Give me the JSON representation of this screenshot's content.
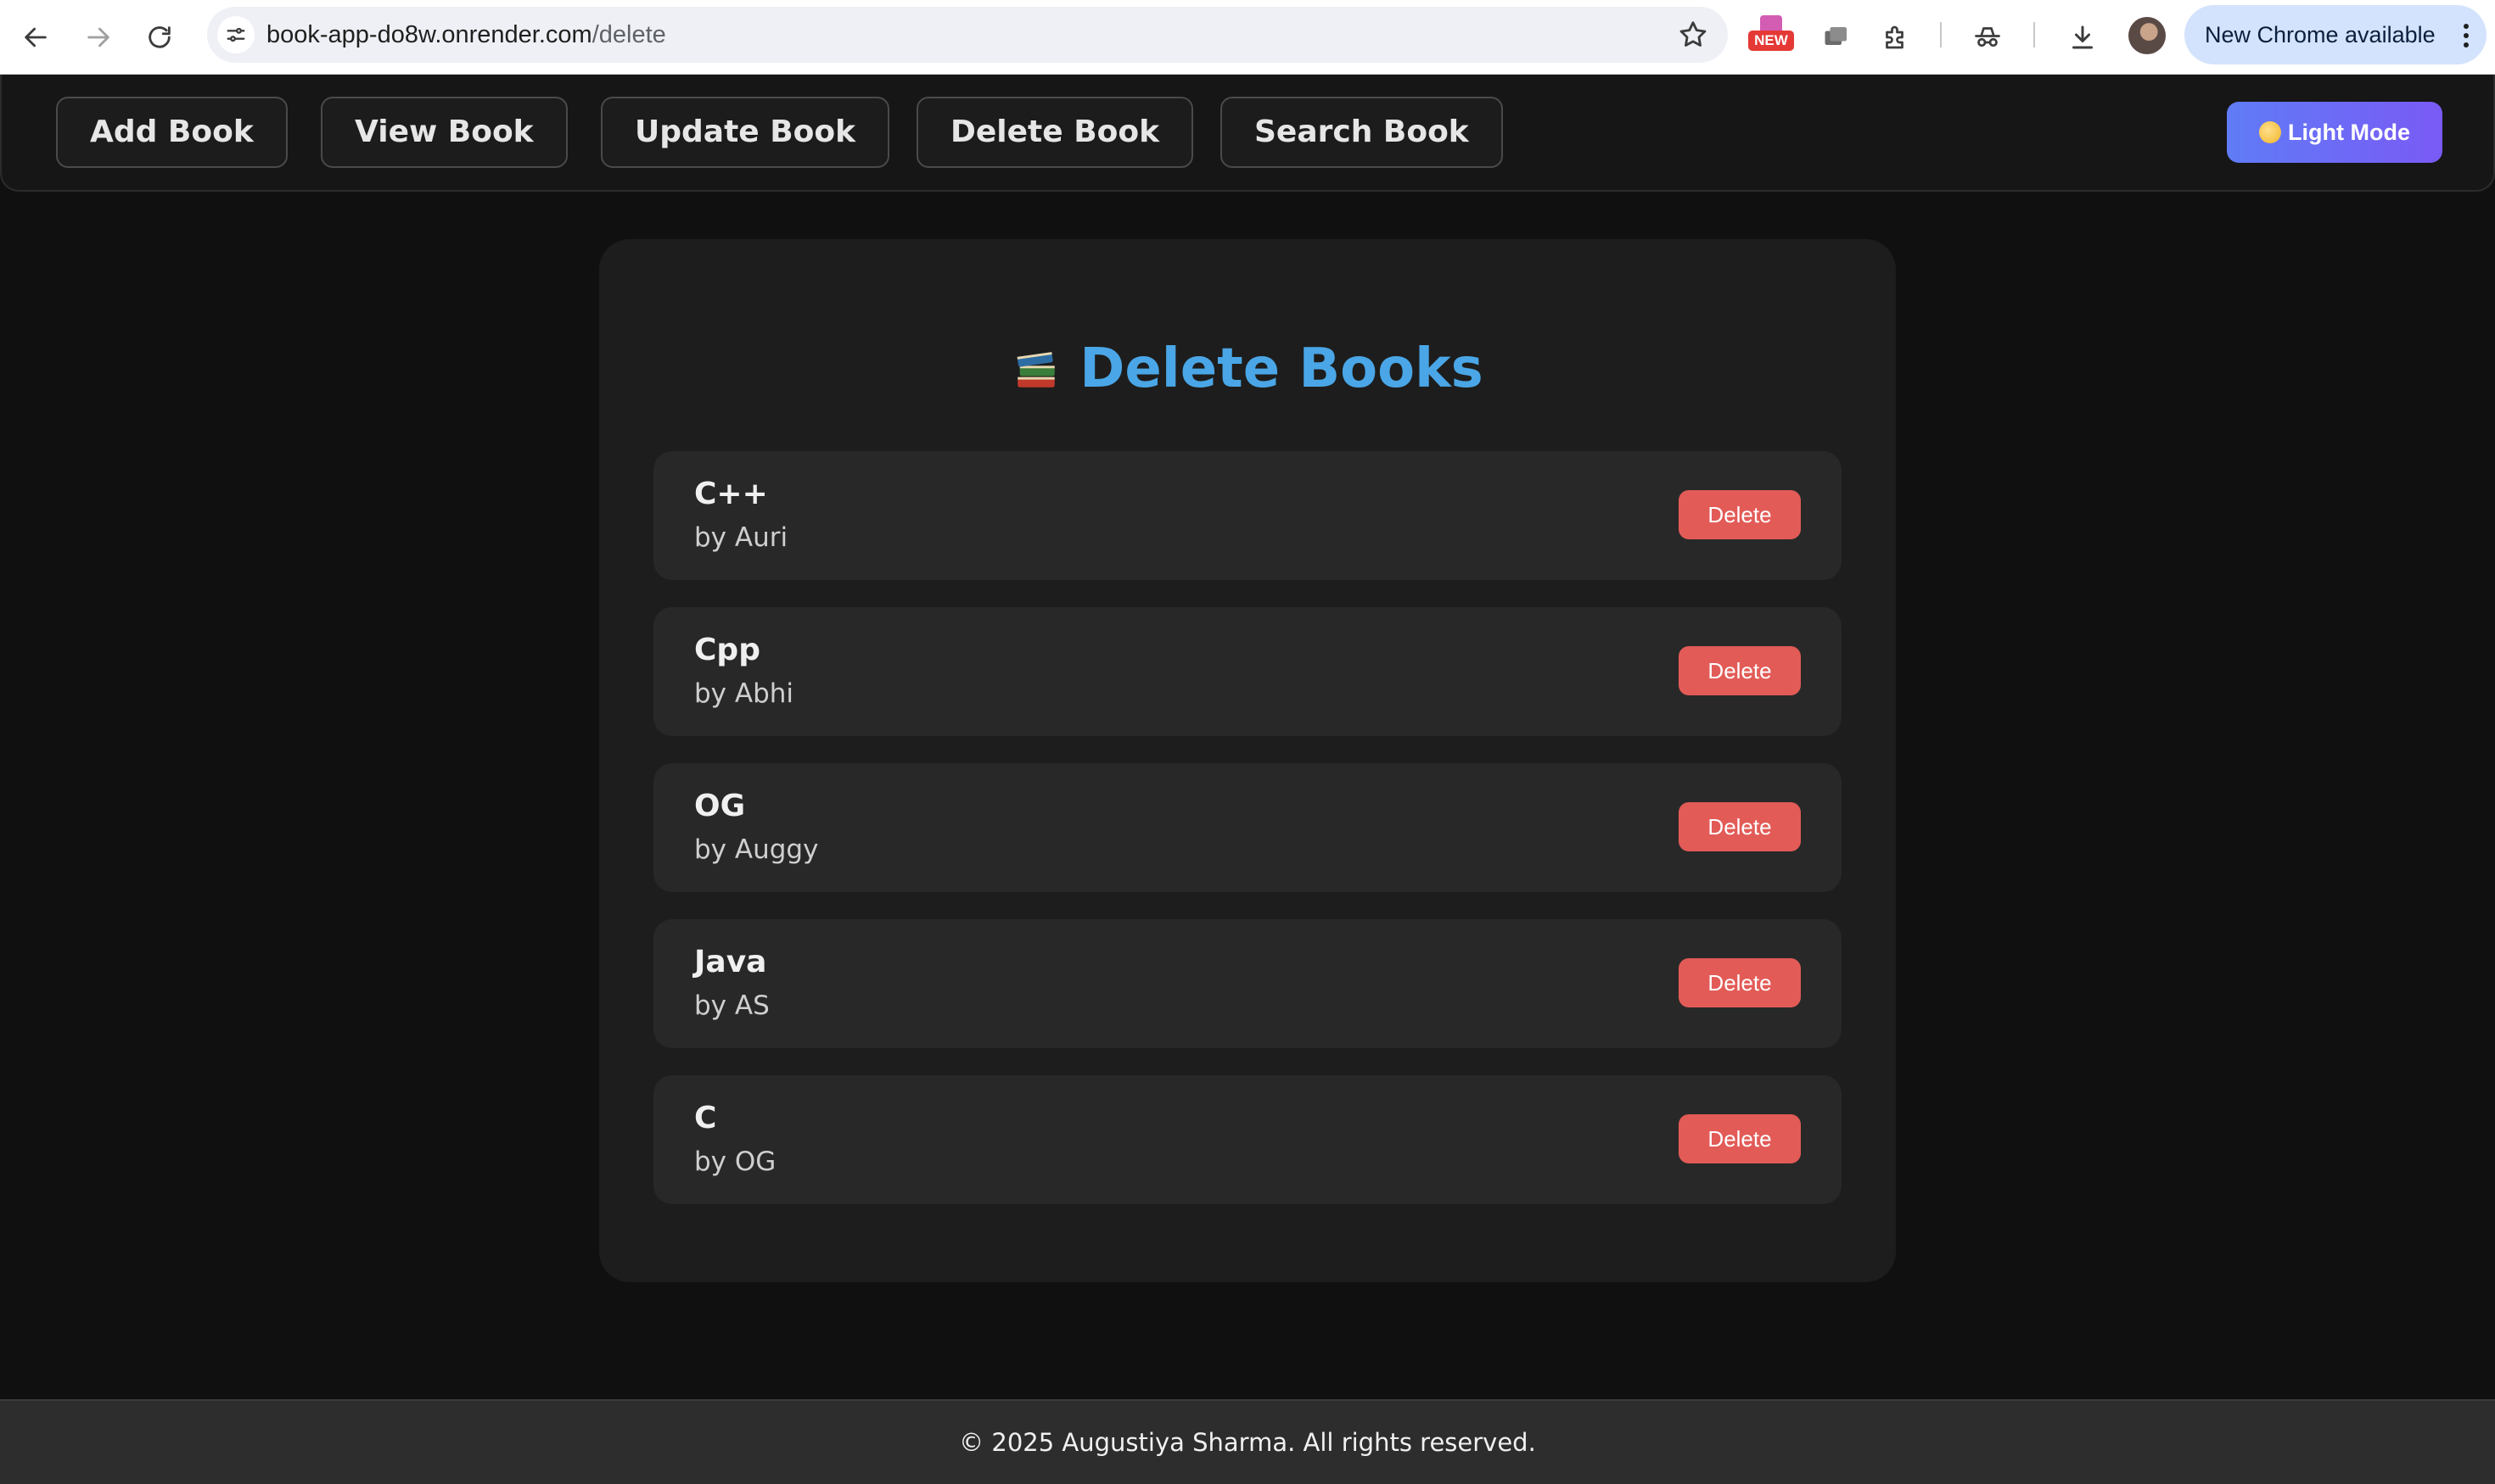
{
  "browser": {
    "url_host": "book-app-do8w.onrender.com",
    "url_path": "/delete",
    "new_badge": "NEW",
    "update_label": "New Chrome available"
  },
  "navbar": {
    "links": [
      {
        "label": "Add Book"
      },
      {
        "label": "View Book"
      },
      {
        "label": "Update Book"
      },
      {
        "label": "Delete Book"
      },
      {
        "label": "Search Book"
      }
    ],
    "theme_toggle": "Light Mode",
    "theme_toggle_icon": "sun-emoji-icon"
  },
  "main": {
    "title": "Delete Books",
    "title_icon": "books-icon",
    "title_color": "#4aa6e6",
    "books": [
      {
        "title": "C++",
        "author": "by Auri",
        "action": "Delete"
      },
      {
        "title": "Cpp",
        "author": "by Abhi",
        "action": "Delete"
      },
      {
        "title": "OG",
        "author": "by Auggy",
        "action": "Delete"
      },
      {
        "title": "Java",
        "author": "by AS",
        "action": "Delete"
      },
      {
        "title": "C",
        "author": "by OG",
        "action": "Delete"
      }
    ],
    "delete_color": "#e25b57"
  },
  "footer": {
    "text": "© 2025 Augustiya Sharma. All rights reserved."
  }
}
